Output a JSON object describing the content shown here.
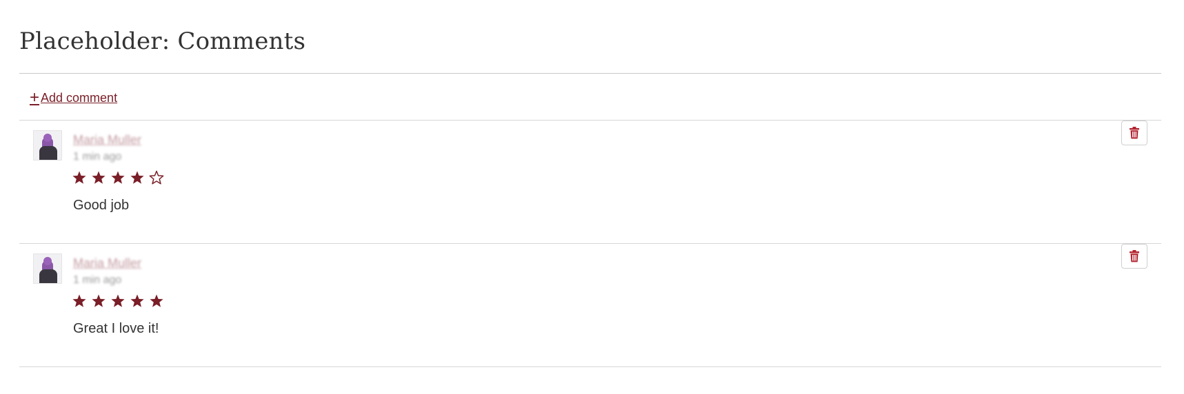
{
  "page": {
    "title": "Placeholder: Comments"
  },
  "actions": {
    "add_comment_label": " Add comment",
    "add_icon": "plus-icon",
    "delete_icon": "trash-icon"
  },
  "colors": {
    "accent": "#7a1e27",
    "star_filled": "#7a1e27",
    "author_link": "#c39aa1",
    "text": "#333333",
    "rule": "#d6d6d6"
  },
  "comments": [
    {
      "author": "Maria Muller",
      "timestamp": "1 min ago",
      "rating": 4,
      "max_rating": 5,
      "text": "Good job"
    },
    {
      "author": "Maria Muller",
      "timestamp": "1 min ago",
      "rating": 5,
      "max_rating": 5,
      "text": "Great I love it!"
    }
  ]
}
